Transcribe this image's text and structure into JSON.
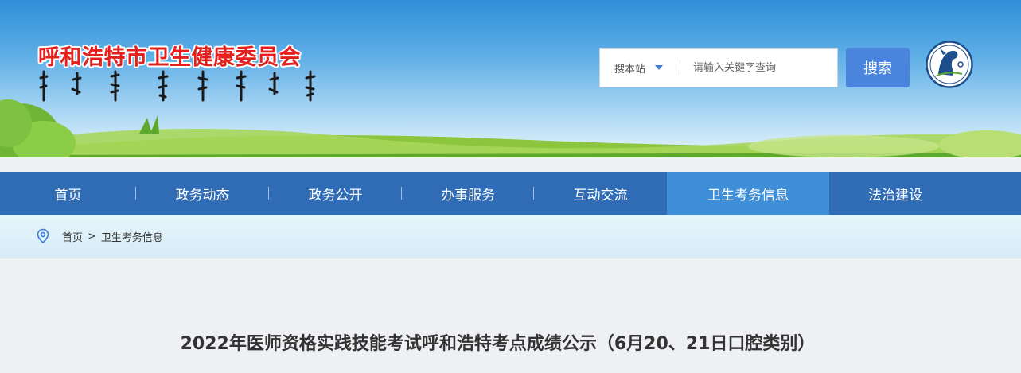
{
  "header": {
    "site_title": "呼和浩特市卫生健康委员会",
    "mongolian_title_image": "mongolian-script-title",
    "search": {
      "scope_label": "搜本站",
      "placeholder": "请输入关键字查询",
      "button_label": "搜索"
    },
    "emblem_icon": "horse-emblem-icon"
  },
  "nav": {
    "items": [
      {
        "label": "首页"
      },
      {
        "label": "政务动态"
      },
      {
        "label": "政务公开"
      },
      {
        "label": "办事服务"
      },
      {
        "label": "互动交流"
      },
      {
        "label": "卫生考务信息",
        "active": true
      },
      {
        "label": "法治建设"
      }
    ]
  },
  "breadcrumb": {
    "icon": "location-pin-icon",
    "home": "首页",
    "separator": ">",
    "current": "卫生考务信息"
  },
  "article": {
    "title": "2022年医师资格实践技能考试呼和浩特考点成绩公示（6月20、21日口腔类别）"
  },
  "colors": {
    "title_red": "#e3201b",
    "nav_blue": "#2f6cb5",
    "nav_active": "#3f8fd8",
    "search_button": "#4a84dc"
  }
}
